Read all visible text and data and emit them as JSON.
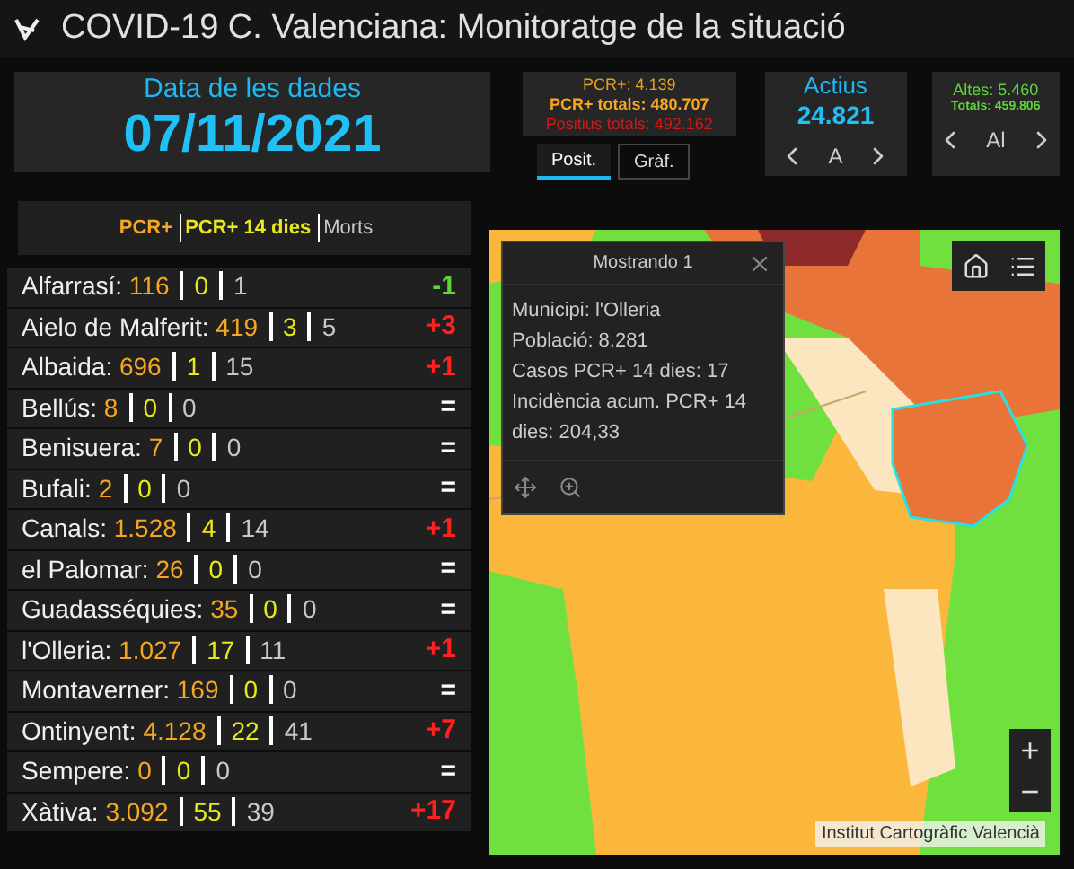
{
  "header": {
    "title": "COVID-19 C. Valenciana: Monitoratge de la situació"
  },
  "date_panel": {
    "label": "Data de les dades",
    "value": "07/11/2021"
  },
  "positives_panel": {
    "pcr": "PCR+: 4.139",
    "pcr_total": "PCR+ totals: 480.707",
    "positive_total": "Positius totals: 492.162",
    "tabs": [
      {
        "label": "Posit.",
        "selected": true
      },
      {
        "label": "Gràf.",
        "selected": false
      }
    ]
  },
  "active_panel": {
    "label": "Actius",
    "value": "24.821",
    "pager": "A"
  },
  "discharges_panel": {
    "discharges": "Altes: 5.460",
    "total": "Totals: 459.806",
    "pager": "Al"
  },
  "list": {
    "legend": [
      {
        "text": "PCR+",
        "kind": "pcr"
      },
      {
        "text": "PCR+ 14 dies",
        "kind": "d14"
      },
      {
        "text": "Morts",
        "kind": "deaths"
      }
    ],
    "rows": [
      {
        "name": "Alfarrasí:",
        "pcr": "116",
        "d14": "0",
        "deaths": "1",
        "change": "-1",
        "color": "#5fd33a"
      },
      {
        "name": "Aielo de Malferit:",
        "pcr": "419",
        "d14": "3",
        "deaths": "5",
        "change": "+3",
        "color": "#ff2020"
      },
      {
        "name": "Albaida:",
        "pcr": "696",
        "d14": "1",
        "deaths": "15",
        "change": "+1",
        "color": "#ff2020"
      },
      {
        "name": "Bellús:",
        "pcr": "8",
        "d14": "0",
        "deaths": "0",
        "change": "=",
        "color": "#ffffff"
      },
      {
        "name": "Benisuera:",
        "pcr": "7",
        "d14": "0",
        "deaths": "0",
        "change": "=",
        "color": "#ffffff"
      },
      {
        "name": "Bufali:",
        "pcr": "2",
        "d14": "0",
        "deaths": "0",
        "change": "=",
        "color": "#ffffff"
      },
      {
        "name": "Canals:",
        "pcr": "1.528",
        "d14": "4",
        "deaths": "14",
        "change": "+1",
        "color": "#ff2020"
      },
      {
        "name": "el Palomar:",
        "pcr": "26",
        "d14": "0",
        "deaths": "0",
        "change": "=",
        "color": "#ffffff"
      },
      {
        "name": "Guadasséquies:",
        "pcr": "35",
        "d14": "0",
        "deaths": "0",
        "change": "=",
        "color": "#ffffff"
      },
      {
        "name": "l'Olleria:",
        "pcr": "1.027",
        "d14": "17",
        "deaths": "11",
        "change": "+1",
        "color": "#ff2020"
      },
      {
        "name": "Montaverner:",
        "pcr": "169",
        "d14": "0",
        "deaths": "0",
        "change": "=",
        "color": "#ffffff"
      },
      {
        "name": "Ontinyent:",
        "pcr": "4.128",
        "d14": "22",
        "deaths": "41",
        "change": "+7",
        "color": "#ff2020"
      },
      {
        "name": "Sempere:",
        "pcr": "0",
        "d14": "0",
        "deaths": "0",
        "change": "=",
        "color": "#ffffff"
      },
      {
        "name": "Xàtiva:",
        "pcr": "3.092",
        "d14": "55",
        "deaths": "39",
        "change": "+17",
        "color": "#ff2020"
      }
    ]
  },
  "map": {
    "popup": {
      "title": "Mostrando 1",
      "lines": [
        "Municipi: l'Olleria",
        "Població: 8.281",
        "Casos PCR+ 14 dies: 17",
        "Incidència acum. PCR+ 14 dies: 204,33"
      ]
    },
    "zoom_in": "+",
    "zoom_out": "−",
    "attribution": "Institut Cartogràfic Valencià"
  }
}
